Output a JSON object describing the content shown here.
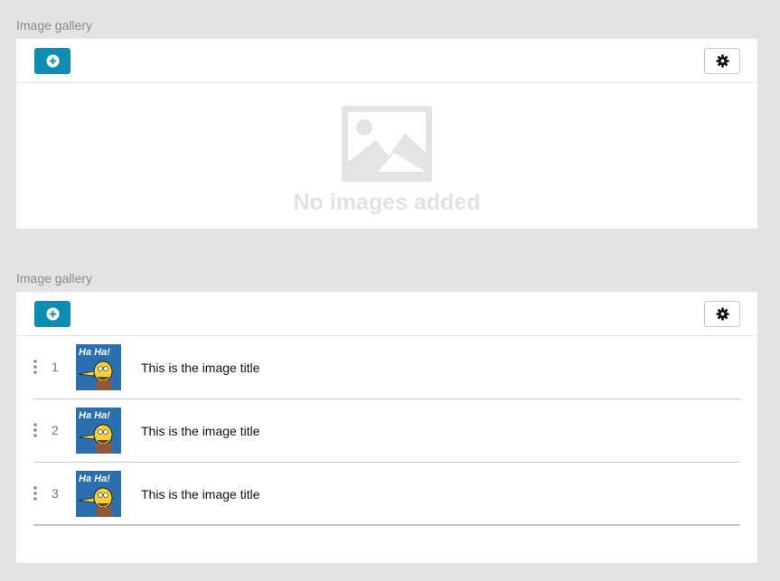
{
  "galleries": [
    {
      "label": "Image gallery",
      "add_icon": "plus-circle-icon",
      "settings_icon": "gear-icon",
      "empty_message": "No images added"
    },
    {
      "label": "Image gallery",
      "add_icon": "plus-circle-icon",
      "settings_icon": "gear-icon",
      "items": [
        {
          "index": "1",
          "thumb_text": "Ha Ha!",
          "title": "This is the image title"
        },
        {
          "index": "2",
          "thumb_text": "Ha Ha!",
          "title": "This is the image title"
        },
        {
          "index": "3",
          "thumb_text": "Ha Ha!",
          "title": "This is the image title"
        }
      ]
    }
  ],
  "colors": {
    "background": "#e3e3e3",
    "accent": "#0e8db3",
    "placeholder": "#e2e2e2"
  }
}
